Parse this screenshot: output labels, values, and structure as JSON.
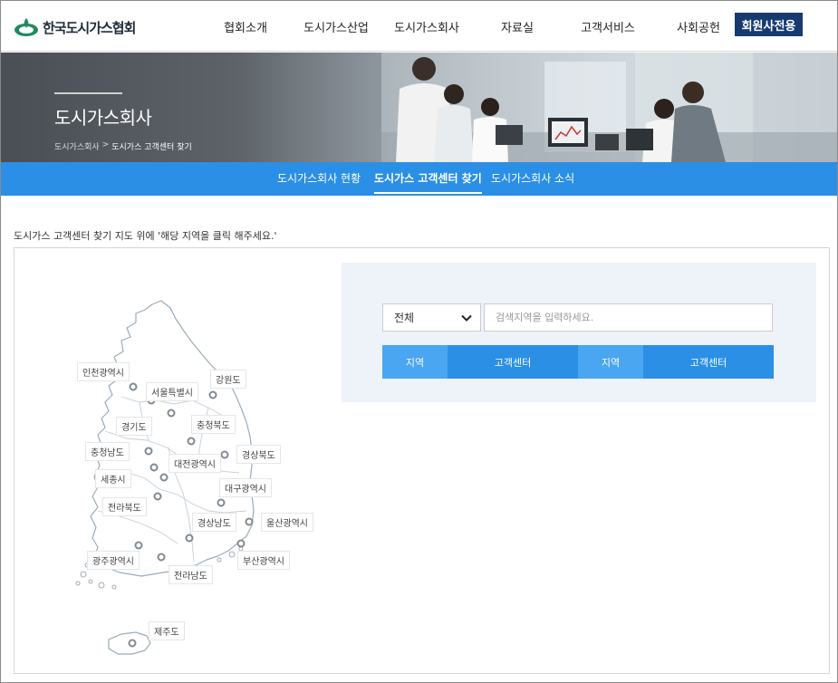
{
  "header": {
    "logo_text": "한국도시가스협회",
    "nav": [
      "협회소개",
      "도시가스산업",
      "도시가스회사",
      "자료실",
      "고객서비스",
      "사회공헌"
    ],
    "member_button": "회원사전용"
  },
  "hero": {
    "title": "도시가스회사",
    "breadcrumb": [
      "도시가스회사",
      ">",
      "도시가스 고객센터 찾기"
    ]
  },
  "subnav": {
    "items": [
      "도시가스회사 현황",
      "도시가스 고객센터 찾기",
      "도시가스회사 소식"
    ],
    "active_index": 1
  },
  "content": {
    "instruction": "도시가스 고객센터 찾기 지도 위에 '해당 지역을 클릭 해주세요.'"
  },
  "map": {
    "regions": [
      "인천광역시",
      "서울특별시",
      "강원도",
      "경기도",
      "충청북도",
      "충청남도",
      "경상북도",
      "세종시",
      "대전광역시",
      "대구광역시",
      "전라북도",
      "경상남도",
      "울산광역시",
      "광주광역시",
      "부산광역시",
      "전라남도",
      "제주도"
    ]
  },
  "search": {
    "select_value": "전체",
    "input_placeholder": "검색지역을 입력하세요.",
    "columns": [
      "지역",
      "고객센터",
      "지역",
      "고객센터"
    ]
  },
  "colors": {
    "primary_blue": "#2b8fe6",
    "light_blue": "#4aa6f0",
    "navy": "#173a6f",
    "panel_bg": "#eef3fa"
  }
}
